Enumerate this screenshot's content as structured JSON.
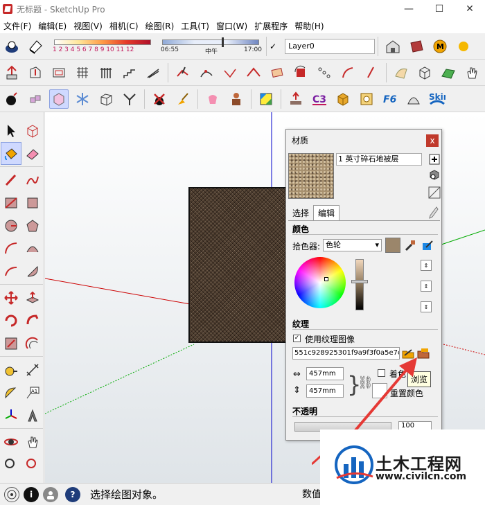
{
  "window": {
    "title": "无标题 - SketchUp Pro",
    "controls": [
      "—",
      "☐",
      "✕"
    ]
  },
  "menu": [
    "文件(F)",
    "编辑(E)",
    "视图(V)",
    "相机(C)",
    "绘图(R)",
    "工具(T)",
    "窗口(W)",
    "扩展程序",
    "帮助(H)"
  ],
  "shadow": {
    "scale_labels": "1 2 3 4 5 6 7 8 9 10 11 12",
    "time_start": "06:55",
    "time_mid": "中午",
    "time_end": "17:00"
  },
  "layer": {
    "name": "Layer0",
    "check": "✓"
  },
  "materials": {
    "title": "材质",
    "close": "x",
    "material_name": "1 英寸碎石地被层",
    "tab_select": "选择",
    "tab_edit": "编辑",
    "color_heading": "颜色",
    "picker_label": "拾色器:",
    "picker_value": "色轮",
    "texture_heading": "纹理",
    "use_texture_label": "使用纹理图像",
    "use_texture_check": "✓",
    "texture_file": "551c928925301f9a9f3f0a5e7c",
    "width": "457mm",
    "height": "457mm",
    "colorize_label": "着色",
    "reset_color_label": "重置颜色",
    "opacity_heading": "不透明",
    "opacity_value": "100"
  },
  "tooltip": "浏览",
  "status": {
    "text": "选择绘图对象。",
    "value_label": "数值"
  },
  "watermark": {
    "title": "土木工程网",
    "url": "www.civilcn.com"
  },
  "colors": {
    "accent_red": "#c0392b",
    "axis_red": "#cc0000",
    "axis_green": "#00aa00",
    "axis_blue": "#0000cc"
  }
}
